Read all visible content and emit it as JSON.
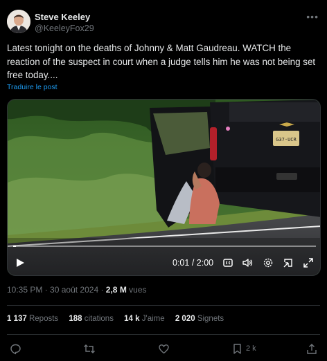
{
  "author": {
    "name": "Steve Keeley",
    "handle": "@KeeleyFox29",
    "more_icon": "more-horizontal-icon"
  },
  "tweet": {
    "text": "Latest tonight on the deaths of Johnny & Matt Gaudreau.  WATCH the reaction of the suspect in court when a judge tells him he was not being set free today....",
    "translate_label": "Traduire le post"
  },
  "video": {
    "current_time": "0:01",
    "separator": "/",
    "duration": "2:00",
    "progress_fraction": 0.01,
    "plate_text": "G37·UCR"
  },
  "meta": {
    "time": "10:35 PM",
    "date": "30 août 2024",
    "views_count": "2,8 M",
    "views_label": "vues"
  },
  "stats": [
    {
      "count": "1 137",
      "label": "Reposts"
    },
    {
      "count": "188",
      "label": "citations"
    },
    {
      "count": "14 k",
      "label": "J'aime"
    },
    {
      "count": "2 020",
      "label": "Signets"
    }
  ],
  "actions": {
    "bookmark_count": "2 k"
  },
  "colors": {
    "background": "#000000",
    "text": "#e7e9ea",
    "muted": "#71767b",
    "link": "#1d9bf0",
    "divider": "#2f3336"
  }
}
